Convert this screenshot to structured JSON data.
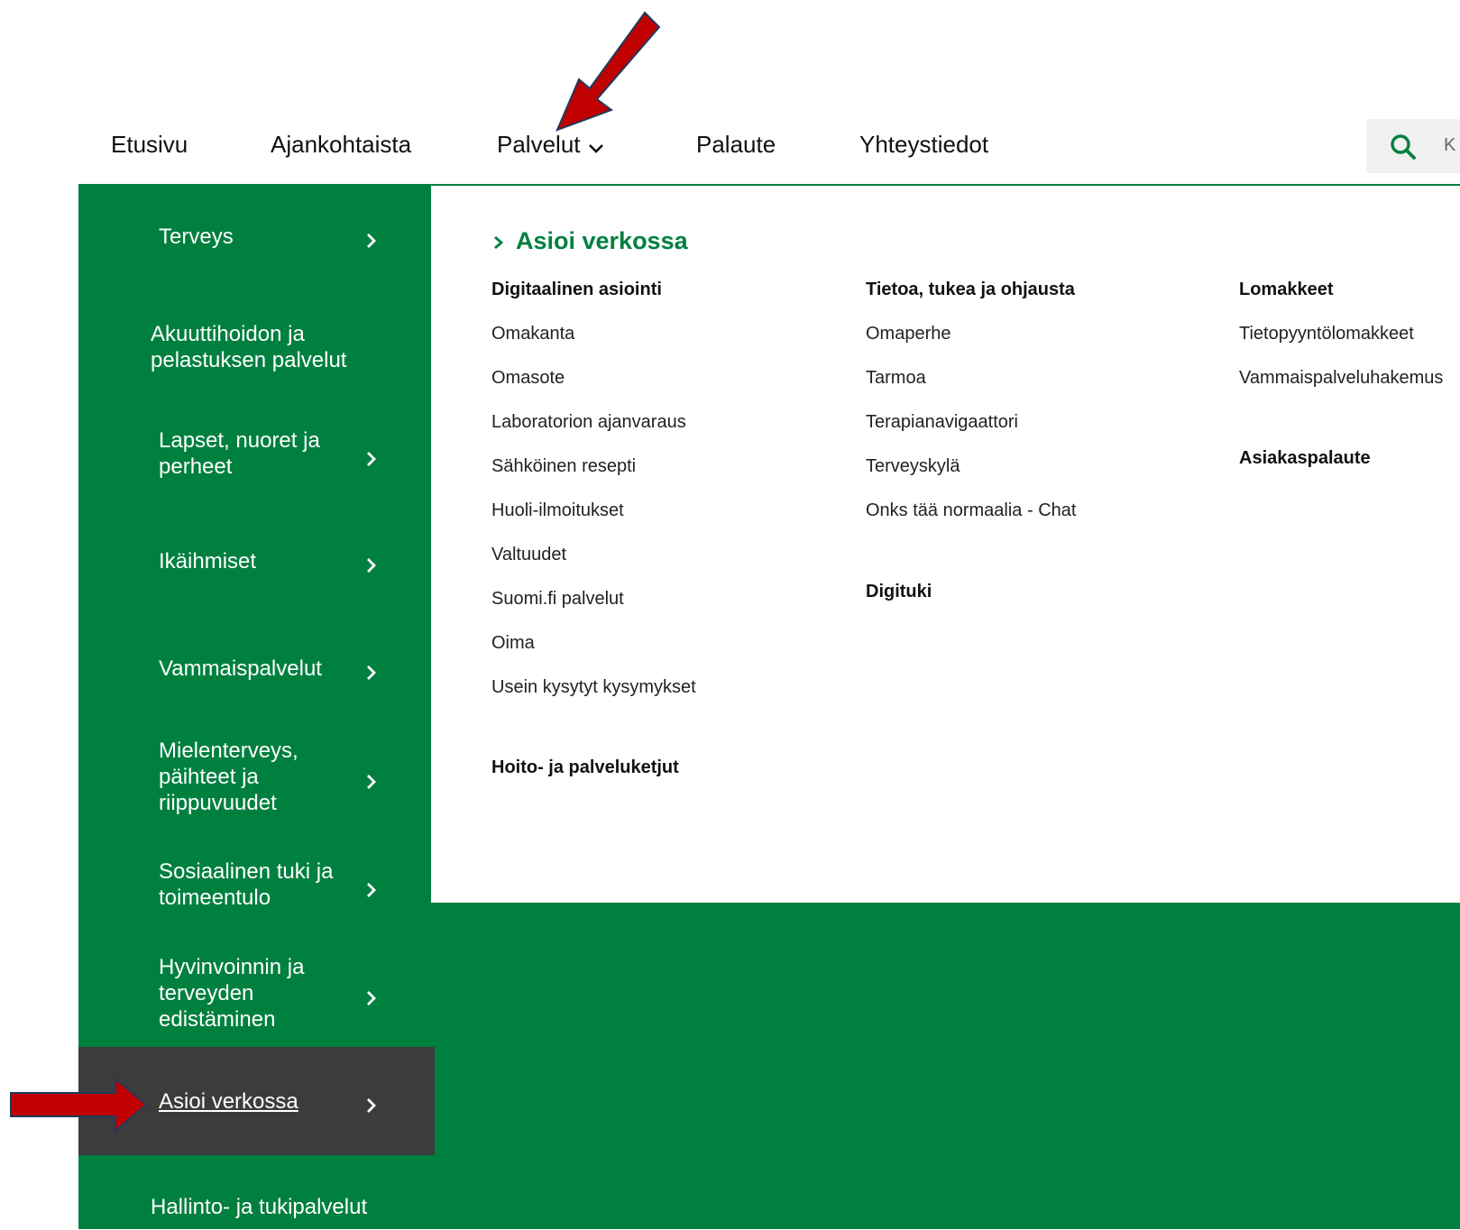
{
  "topnav": {
    "items": [
      "Etusivu",
      "Ajankohtaista",
      "Palvelut",
      "Palaute",
      "Yhteystiedot"
    ],
    "search_placeholder": "K"
  },
  "sidebar": {
    "items": [
      {
        "label": "Terveys"
      },
      {
        "label": "Akuuttihoidon ja pelastuksen palvelut"
      },
      {
        "label": "Lapset, nuoret ja perheet"
      },
      {
        "label": "Ikäihmiset"
      },
      {
        "label": "Vammaispalvelut"
      },
      {
        "label": "Mielenterveys, päihteet ja riippuvuudet"
      },
      {
        "label": "Sosiaalinen tuki ja toimeentulo"
      },
      {
        "label": "Hyvinvoinnin ja terveyden edistäminen"
      },
      {
        "label": "Asioi verkossa"
      },
      {
        "label": "Hallinto- ja tukipalvelut"
      }
    ]
  },
  "panel": {
    "title": "Asioi verkossa",
    "col1": {
      "heading": "Digitaalinen asiointi",
      "links": [
        "Omakanta",
        "Omasote",
        "Laboratorion ajanvaraus",
        "Sähköinen resepti",
        "Huoli-ilmoitukset",
        "Valtuudet",
        "Suomi.fi palvelut",
        "Oima",
        "Usein kysytyt kysymykset"
      ],
      "heading2": "Hoito- ja palveluketjut"
    },
    "col2": {
      "heading": "Tietoa, tukea ja ohjausta",
      "links": [
        "Omaperhe",
        "Tarmoa",
        "Terapianavigaattori",
        "Terveyskylä",
        "Onks tää normaalia - Chat"
      ],
      "heading2": "Digituki"
    },
    "col3": {
      "heading": "Lomakkeet",
      "links": [
        "Tietopyyntölomakkeet",
        "Vammaispalveluhakemus"
      ],
      "heading2": "Asiakaspalaute"
    }
  },
  "colors": {
    "brand_green": "#00803f",
    "active_bg": "#3c3c3c",
    "annotation_red": "#c00000"
  }
}
